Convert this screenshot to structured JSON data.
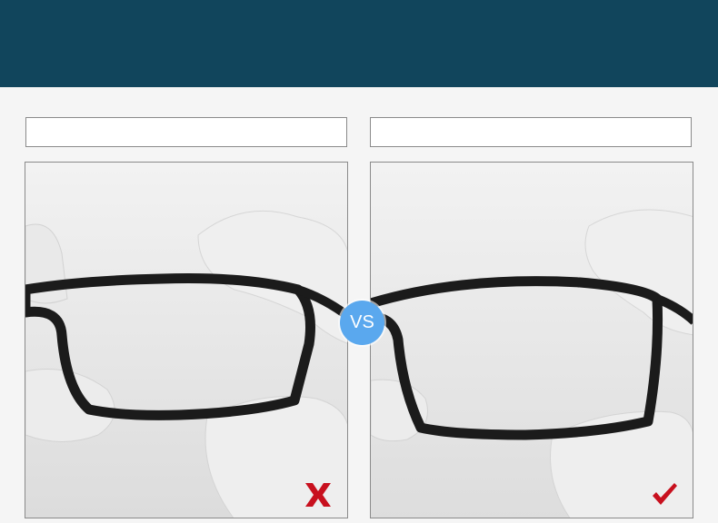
{
  "header": {
    "title": ""
  },
  "left_panel": {
    "label": "",
    "verdict_icon": "cross-icon"
  },
  "right_panel": {
    "label": "",
    "verdict_icon": "check-icon"
  },
  "vs_badge": {
    "text": "VS"
  },
  "colors": {
    "header": "#11455c",
    "vs_badge": "#5aa8ee",
    "verdict_mark": "#c8101e",
    "frame": "#1b1b1b"
  }
}
